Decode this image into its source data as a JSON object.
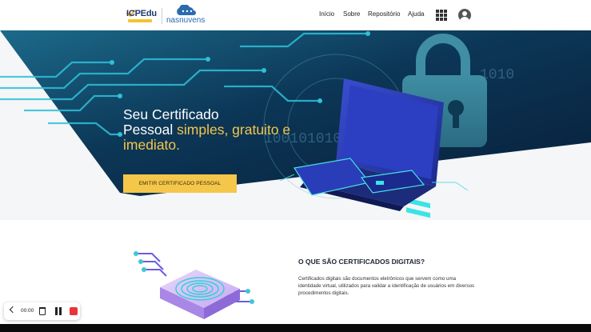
{
  "header": {
    "logo_icp": "ICPEdu",
    "logo_nasnuvens": "nasnuvens",
    "nav": [
      "Início",
      "Sobre",
      "Repositório",
      "Ajuda"
    ],
    "apps_icon": "apps-grid-icon",
    "user_icon": "account-circle-icon"
  },
  "hero": {
    "title_line1": "Seu Certificado",
    "title_line2_plain": "Pessoal ",
    "title_line2_highlight": "simples, gratuito e",
    "title_line3_highlight": "imediato.",
    "cta_label": "EMITIR CERTIFICADO PESSOAL",
    "colors": {
      "highlight": "#f4c64a",
      "dark": "#0b2a4a",
      "accent": "#19c3c9"
    }
  },
  "section": {
    "title": "O QUE SÃO CERTIFICADOS DIGITAIS?",
    "text": "Certificados digitais são documentos eletrônicos que servem como uma identidade virtual, utilizados para validar a identificação de usuários em diversos procedimentos digitais."
  },
  "recorder": {
    "time": "00:00",
    "icons": [
      "chevron-left-icon",
      "trash-icon",
      "pause-icon",
      "stop-icon"
    ]
  }
}
